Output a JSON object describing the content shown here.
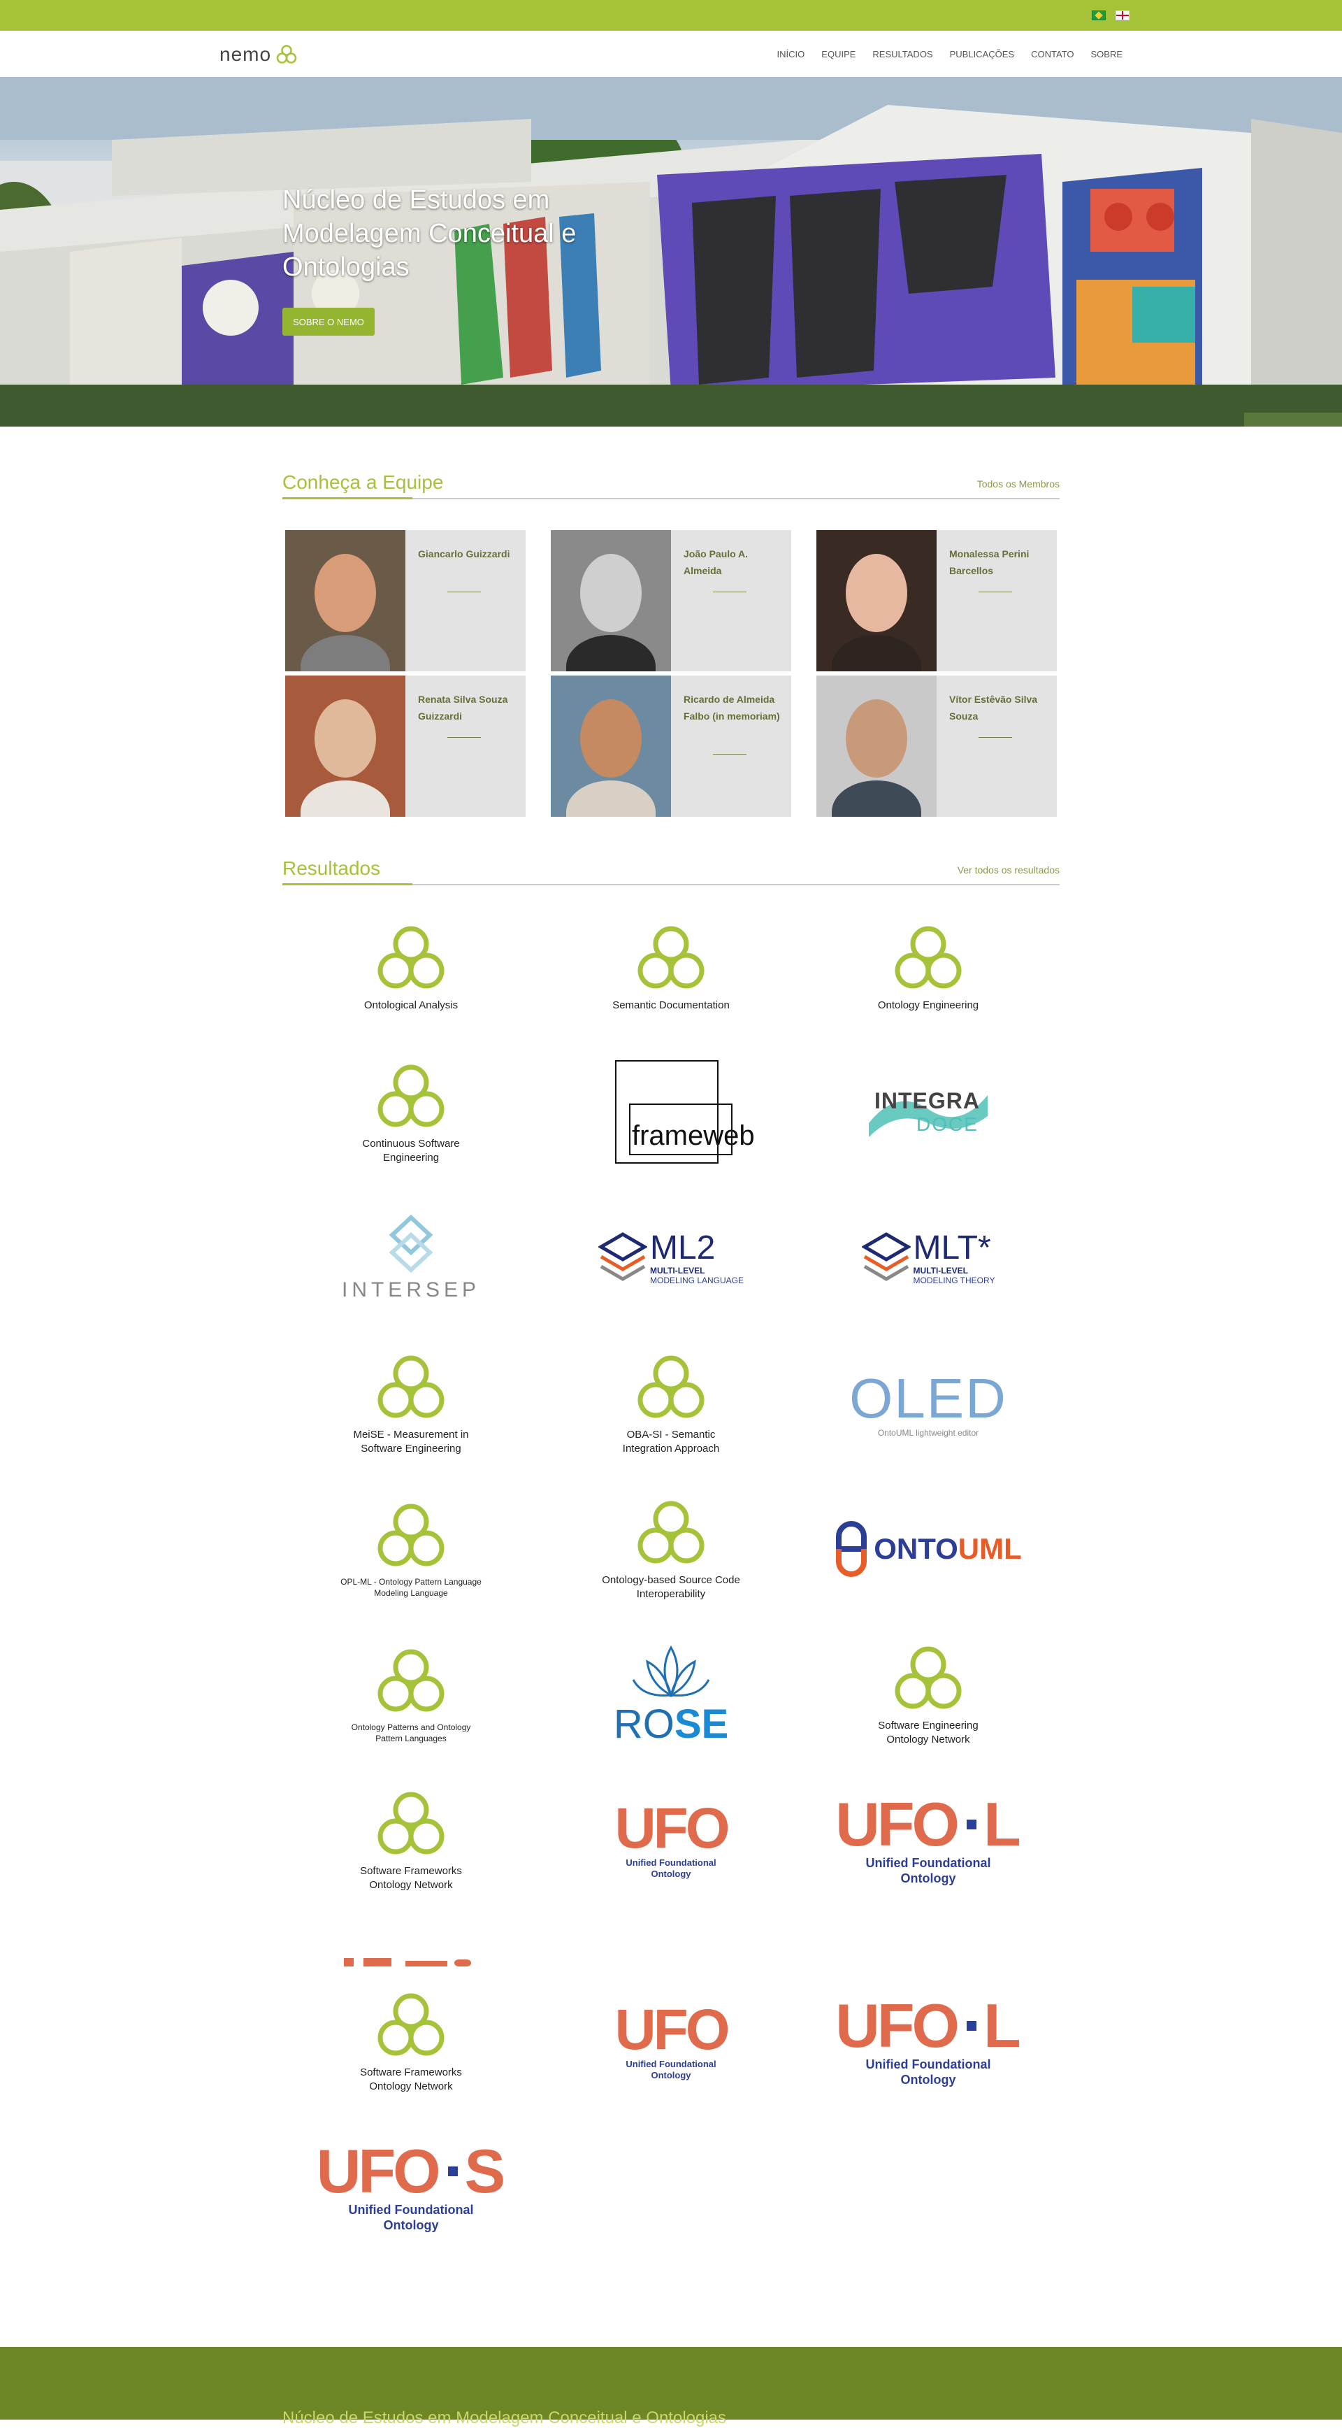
{
  "brand": {
    "name": "nemo",
    "accent": "#a5c238"
  },
  "topbar": {
    "flags": [
      "brazil-flag-icon",
      "uk-flag-icon"
    ]
  },
  "nav": {
    "items": [
      "INÍCIO",
      "EQUIPE",
      "RESULTADOS",
      "PUBLICAÇÕES",
      "CONTATO",
      "SOBRE"
    ]
  },
  "hero": {
    "title": "Núcleo de Estudos em Modelagem Conceitual e Ontologias",
    "button": "SOBRE O NEMO"
  },
  "team": {
    "title": "Conheça a Equipe",
    "link": "Todos os Membros",
    "members": [
      {
        "name": "Giancarlo Guizzardi"
      },
      {
        "name": "João Paulo A. Almeida"
      },
      {
        "name": "Monalessa Perini Barcellos"
      },
      {
        "name": "Renata Silva Souza Guizzardi"
      },
      {
        "name": "Ricardo de Almeida Falbo (in memoriam)"
      },
      {
        "name": "Vítor Estêvão Silva Souza"
      }
    ]
  },
  "results": {
    "title": "Resultados",
    "link": "Ver todos os resultados",
    "items": [
      {
        "kind": "nemo",
        "label": "Ontological Analysis"
      },
      {
        "kind": "nemo",
        "label": "Semantic Documentation"
      },
      {
        "kind": "nemo",
        "label": "Ontology Engineering"
      },
      {
        "kind": "nemo",
        "label": "Continuous Software Engineering"
      },
      {
        "kind": "frameweb",
        "text": "frameweb"
      },
      {
        "kind": "integra",
        "text1": "INTEGRA",
        "text2": "DOCE"
      },
      {
        "kind": "intersep",
        "text": "INTERSEP"
      },
      {
        "kind": "ml",
        "big": "ML2",
        "line1": "MULTI-LEVEL",
        "line2": "MODELING LANGUAGE"
      },
      {
        "kind": "ml",
        "big": "MLT*",
        "line1": "MULTI-LEVEL",
        "line2": "MODELING THEORY"
      },
      {
        "kind": "nemo",
        "label": "MeiSE - Measurement in Software Engineering"
      },
      {
        "kind": "nemo",
        "label": "OBA-SI - Semantic Integration Approach"
      },
      {
        "kind": "oled",
        "text": "OLED",
        "sub": "OntoUML lightweight editor"
      },
      {
        "kind": "nemo",
        "label": "OPL-ML - Ontology Pattern Language Modeling Language",
        "small": true
      },
      {
        "kind": "nemo",
        "label": "Ontology-based Source Code Interoperability"
      },
      {
        "kind": "ontouml",
        "text1": "ONTO",
        "text2": "UML"
      },
      {
        "kind": "nemo",
        "label": "Ontology Patterns and Ontology Pattern Languages",
        "small": true
      },
      {
        "kind": "rose",
        "text1": "RO",
        "text2": "SE"
      },
      {
        "kind": "nemo",
        "label": "Software Engineering Ontology Network"
      },
      {
        "kind": "nemo",
        "label": "Software Frameworks Ontology Network"
      },
      {
        "kind": "ufo",
        "big": "UFO",
        "sub": "Unified Foundational Ontology",
        "suffix": ""
      },
      {
        "kind": "ufo",
        "big": "UFO",
        "sub": "Unified Foundational Ontology",
        "suffix": "L"
      },
      {
        "kind": "nemo",
        "label": "Software Frameworks Ontology Network"
      },
      {
        "kind": "ufo",
        "big": "UFO",
        "sub": "Unified Foundational Ontology",
        "suffix": ""
      },
      {
        "kind": "ufo",
        "big": "UFO",
        "sub": "Unified Foundational Ontology",
        "suffix": "L"
      },
      {
        "kind": "ufo",
        "big": "UFO",
        "sub": "Unified Foundational Ontology",
        "suffix": "S"
      }
    ]
  },
  "footer": {
    "text": "Núcleo de Estudos em Modelagem Conceitual e Ontologias"
  }
}
